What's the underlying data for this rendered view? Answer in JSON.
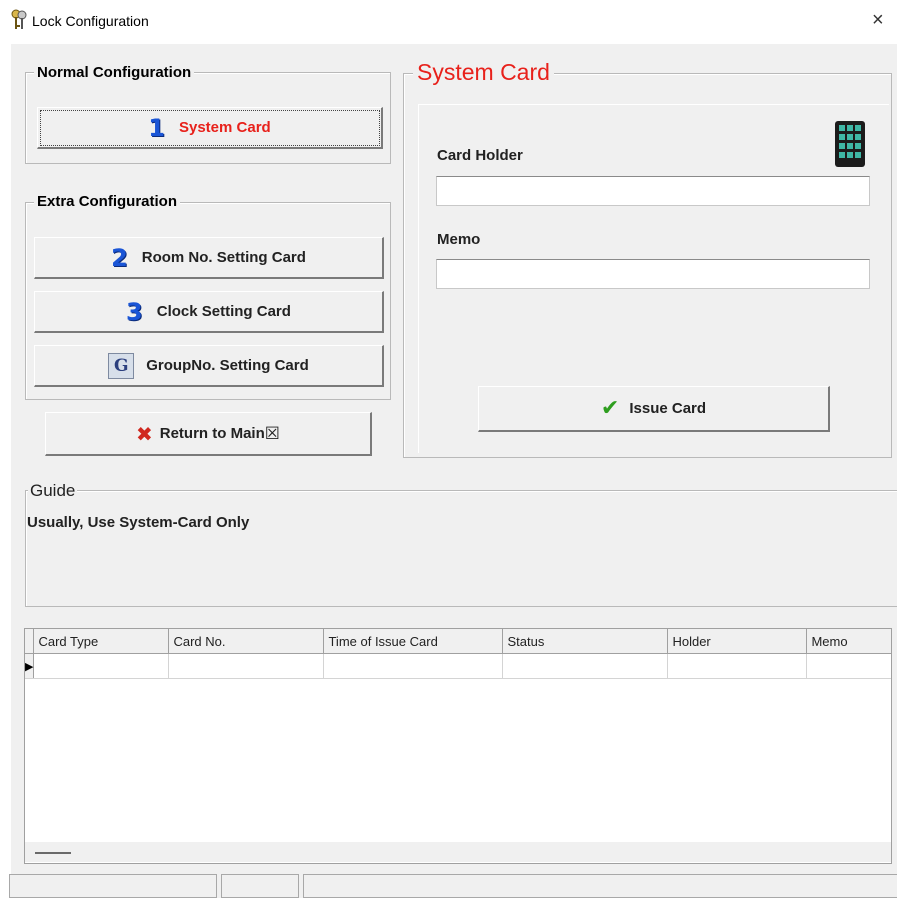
{
  "window": {
    "title": "Lock Configuration",
    "close_glyph": "×",
    "icon": "keys-icon"
  },
  "normal_config": {
    "legend": "Normal Configuration",
    "system_card_button": {
      "number": "1",
      "label": "System Card"
    }
  },
  "extra_config": {
    "legend": "Extra Configuration",
    "buttons": [
      {
        "number": "2",
        "label": "Room No. Setting Card"
      },
      {
        "number": "3",
        "label": "Clock Setting Card"
      },
      {
        "number": "G",
        "label": "GroupNo. Setting Card"
      }
    ]
  },
  "return_button": {
    "label": "Return to Main",
    "shortcut_glyph": "☒"
  },
  "system_card_panel": {
    "legend": "System Card",
    "card_holder_label": "Card Holder",
    "card_holder_value": "",
    "memo_label": "Memo",
    "memo_value": "",
    "issue_button_label": "Issue Card",
    "keypad_icon": "keypad-icon"
  },
  "guide": {
    "legend": "Guide",
    "text": "Usually, Use System-Card Only"
  },
  "table": {
    "columns": [
      "Card Type",
      "Card No.",
      "Time of Issue Card",
      "Status",
      "Holder",
      "Memo"
    ],
    "rows": [
      [
        "",
        "",
        "",
        "",
        "",
        ""
      ]
    ],
    "row_indicator": "▶"
  },
  "colors": {
    "accent_red": "#e8211b",
    "number_blue": "#1a55d6",
    "check_green": "#2e9e1f",
    "cross_red": "#d0281f"
  }
}
